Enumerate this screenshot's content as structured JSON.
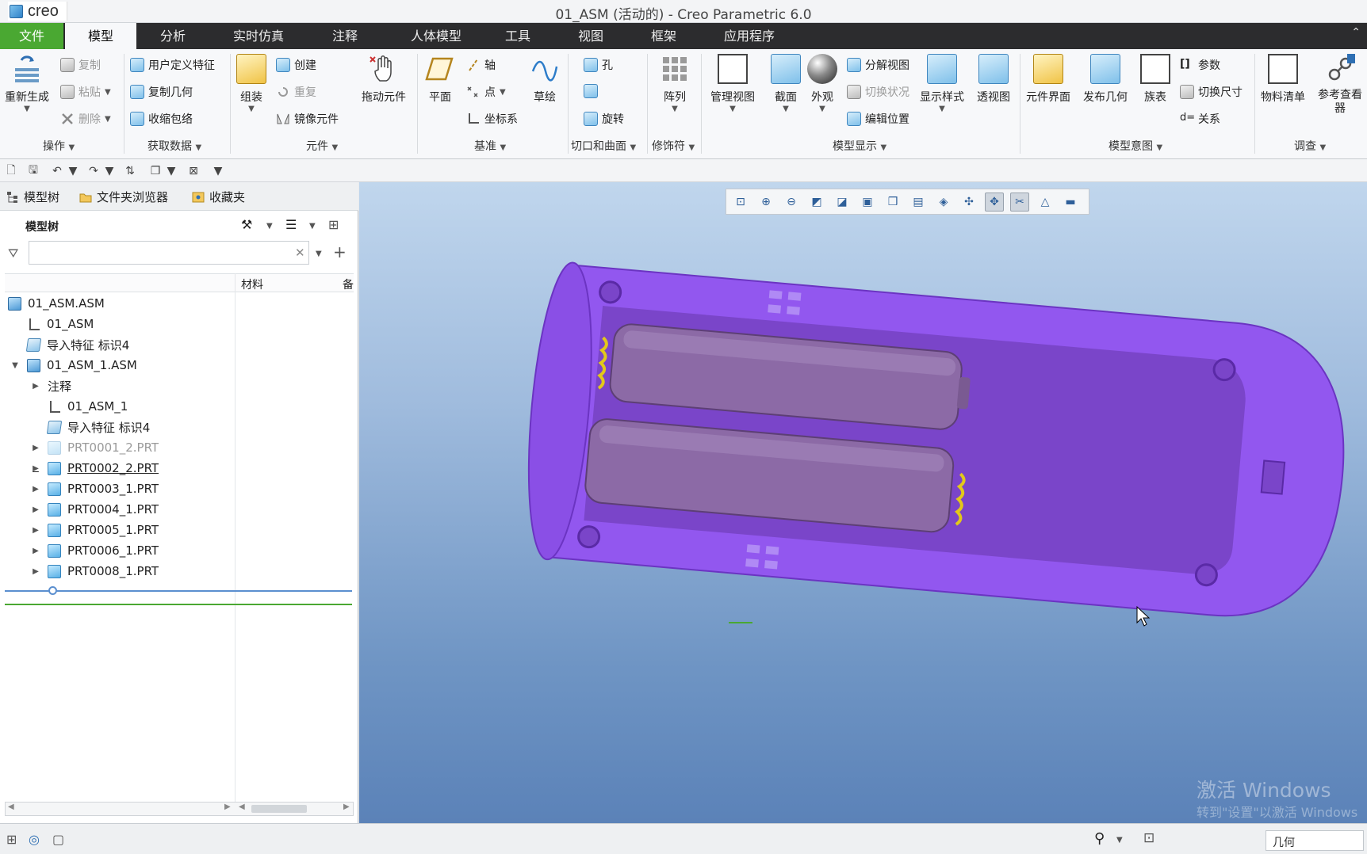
{
  "app": {
    "logo_text": "creo",
    "window_title": "01_ASM (活动的) - Creo Parametric 6.0"
  },
  "menu": {
    "tabs": [
      "文件",
      "模型",
      "分析",
      "实时仿真",
      "注释",
      "人体模型",
      "工具",
      "视图",
      "框架",
      "应用程序"
    ],
    "active_tab": "模型"
  },
  "ribbon": {
    "operations": {
      "regenerate": "重新生成",
      "copy": "复制",
      "paste": "粘贴",
      "delete": "删除",
      "label": "操作"
    },
    "get_data": {
      "udf": "用户定义特征",
      "copy_geom": "复制几何",
      "shrinkwrap": "收缩包络",
      "label": "获取数据"
    },
    "component": {
      "assemble": "组装",
      "create": "创建",
      "repeat": "重复",
      "mirror": "镜像元件",
      "drag": "拖动元件",
      "label": "元件"
    },
    "datum": {
      "plane": "平面",
      "axis": "轴",
      "point": "点",
      "csys": "坐标系",
      "sketch": "草绘",
      "label": "基准"
    },
    "cut_surface": {
      "hole": "孔",
      "revolve": "旋转",
      "label": "切口和曲面"
    },
    "modifiers": {
      "pattern": "阵列",
      "label": "修饰符"
    },
    "model_display": {
      "manage_views": "管理视图",
      "section": "截面",
      "appearance": "外观",
      "explode": "分解视图",
      "toggle_status": "切换状况",
      "edit_position": "编辑位置",
      "display_style": "显示样式",
      "perspective": "透视图",
      "label": "模型显示"
    },
    "model_intent": {
      "comp_interface": "元件界面",
      "publish_geom": "发布几何",
      "family_table": "族表",
      "params": "参数",
      "switch_dims": "切换尺寸",
      "relations": "关系",
      "label": "模型意图"
    },
    "investigate": {
      "bom": "物料清单",
      "ref_viewer": "参考查看器",
      "label": "调查"
    }
  },
  "panel": {
    "tabs": [
      "模型树",
      "文件夹浏览器",
      "收藏夹"
    ],
    "title": "模型树",
    "filter_placeholder": "",
    "columns": [
      "材料",
      "备"
    ],
    "tree": [
      {
        "label": "01_ASM.ASM",
        "icon": "assembly-icon"
      },
      {
        "label": "01_ASM",
        "icon": "csys-icon"
      },
      {
        "label": "导入特征 标识4",
        "icon": "import-feature-icon"
      },
      {
        "label": "01_ASM_1.ASM",
        "icon": "assembly-icon"
      },
      {
        "label": "注释",
        "icon": "none"
      },
      {
        "label": "01_ASM_1",
        "icon": "csys-icon"
      },
      {
        "label": "导入特征 标识4",
        "icon": "import-feature-icon"
      },
      {
        "label": "PRT0001_2.PRT",
        "icon": "part-icon"
      },
      {
        "label": "PRT0002_2.PRT",
        "icon": "part-icon"
      },
      {
        "label": "PRT0003_1.PRT",
        "icon": "part-icon"
      },
      {
        "label": "PRT0004_1.PRT",
        "icon": "part-icon"
      },
      {
        "label": "PRT0005_1.PRT",
        "icon": "part-icon"
      },
      {
        "label": "PRT0006_1.PRT",
        "icon": "part-icon"
      },
      {
        "label": "PRT0008_1.PRT",
        "icon": "part-icon"
      }
    ]
  },
  "viewport": {
    "toolbar_icons": [
      "refit-icon",
      "zoom-in-icon",
      "zoom-out-icon",
      "repaint-icon",
      "view-manager-icon",
      "display-style-icon",
      "saved-orientations-icon",
      "named-views-icon",
      "appearance-icon",
      "datum-display-icon",
      "spin-center-icon",
      "annotation-display-icon",
      "perspective-icon",
      "hidden-line-icon"
    ],
    "watermark_title": "激活 Windows",
    "watermark_sub": "转到\"设置\"以激活 Windows"
  },
  "status": {
    "selection_filter": "几何"
  },
  "colors": {
    "file_tab": "#4aa832",
    "menu_bg": "#2c2c2e",
    "model_purple": "#9a5ff0",
    "battery": "#8c6aa6"
  }
}
